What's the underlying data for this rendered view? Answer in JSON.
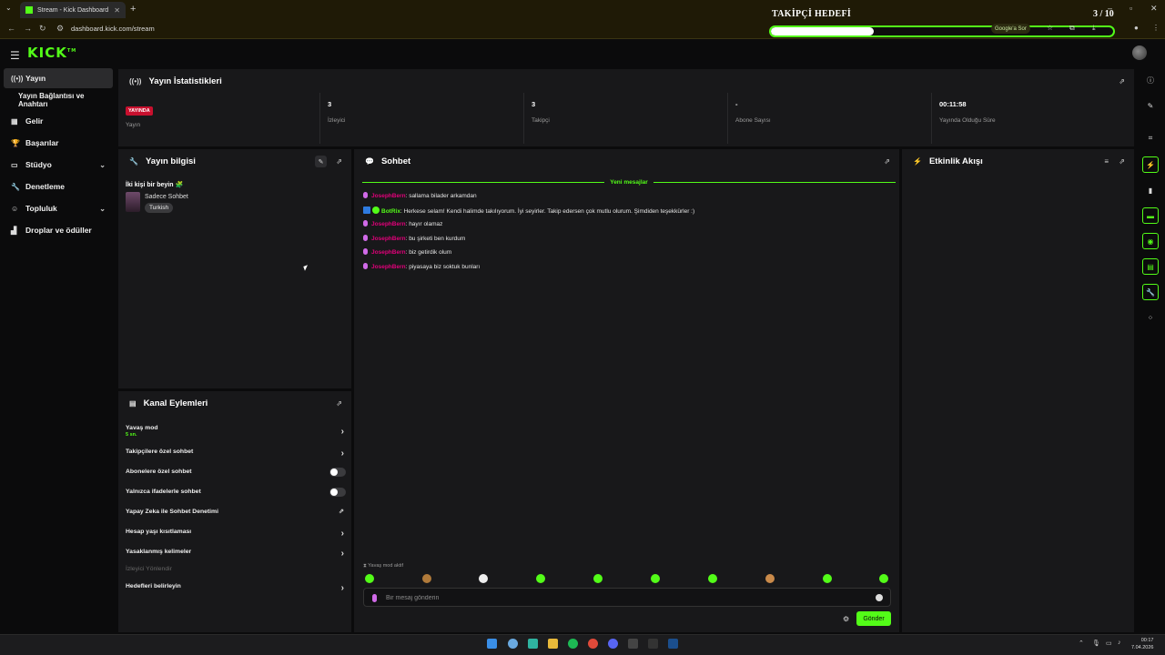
{
  "browser": {
    "tab_title": "Stream - Kick Dashboard",
    "url": "dashboard.kick.com/stream",
    "google_label": "Google'a Sor"
  },
  "overlay": {
    "goal_title": "TAKİPÇİ HEDEFİ",
    "goal_count": "3 / 10",
    "goal_progress": 0.3
  },
  "brand": {
    "logo": "KICK",
    "accent": "#53fc18"
  },
  "sidebar": {
    "items": [
      {
        "label": "Yayın",
        "icon": "broadcast-icon"
      },
      {
        "label": "Yayın Bağlantısı ve Anahtarı"
      },
      {
        "label": "Gelir",
        "icon": "revenue-icon"
      },
      {
        "label": "Başarılar",
        "icon": "trophy-icon"
      },
      {
        "label": "Stüdyo",
        "icon": "studio-icon"
      },
      {
        "label": "Denetleme",
        "icon": "wrench-icon"
      },
      {
        "label": "Topluluk",
        "icon": "community-icon"
      },
      {
        "label": "Droplar ve ödüller",
        "icon": "drops-icon"
      }
    ]
  },
  "stats": {
    "title": "Yayın İstatistikleri",
    "items": [
      {
        "value": "YAYINDA",
        "label": "Yayın"
      },
      {
        "value": "3",
        "label": "İzleyici"
      },
      {
        "value": "3",
        "label": "Takipçi"
      },
      {
        "value": "-",
        "label": "Abone Sayısı"
      },
      {
        "value": "00:11:58",
        "label": "Yayında Olduğu Süre"
      }
    ]
  },
  "stream_info": {
    "title": "Yayın bilgisi",
    "stream_title": "İki kişi bir beyin 🧩",
    "category": "Sadece Sohbet",
    "tag": "Turkish"
  },
  "channel_actions": {
    "title": "Kanal Eylemleri",
    "rows": [
      {
        "label": "Yavaş mod",
        "sub": "5 sn."
      },
      {
        "label": "Takipçilere özel sohbet"
      },
      {
        "label": "Abonelere özel sohbet"
      },
      {
        "label": "Yalnızca ifadelerle sohbet"
      },
      {
        "label": "Yapay Zeka ile Sohbet Denetimi"
      },
      {
        "label": "Hesap yaşı kısıtlaması"
      },
      {
        "label": "Yasaklanmış kelimeler"
      },
      {
        "label": "İzleyici Yönlendir"
      },
      {
        "label": "Hedefleri belirleyin"
      }
    ]
  },
  "chat": {
    "title": "Sohbet",
    "new_messages": "Yeni mesajlar",
    "messages": [
      {
        "user": "JosephBern",
        "text": ": sallama bilader arkamdan"
      },
      {
        "user": "BotRix",
        "text": ": Herkese selam! Kendi halimde takılıyorum. İyi seyirler. Takip edersen çok mutlu olurum. Şimdiden teşekkürler :)"
      },
      {
        "user": "JosephBern",
        "text": ": hayır olamaz"
      },
      {
        "user": "JosephBern",
        "text": ": bu şirketi ben kurdum"
      },
      {
        "user": "JosephBern",
        "text": ": biz getirdik olum"
      },
      {
        "user": "JosephBern",
        "text": ": piyasaya biz soktuk bunları"
      }
    ],
    "slow_mode": "Yavaş mod aktif",
    "placeholder": "Bir mesaj gönderin",
    "send_label": "Gönder"
  },
  "activity": {
    "title": "Etkinlik Akışı"
  },
  "taskbar": {
    "time": "00:17",
    "date": "7.04.2026"
  }
}
